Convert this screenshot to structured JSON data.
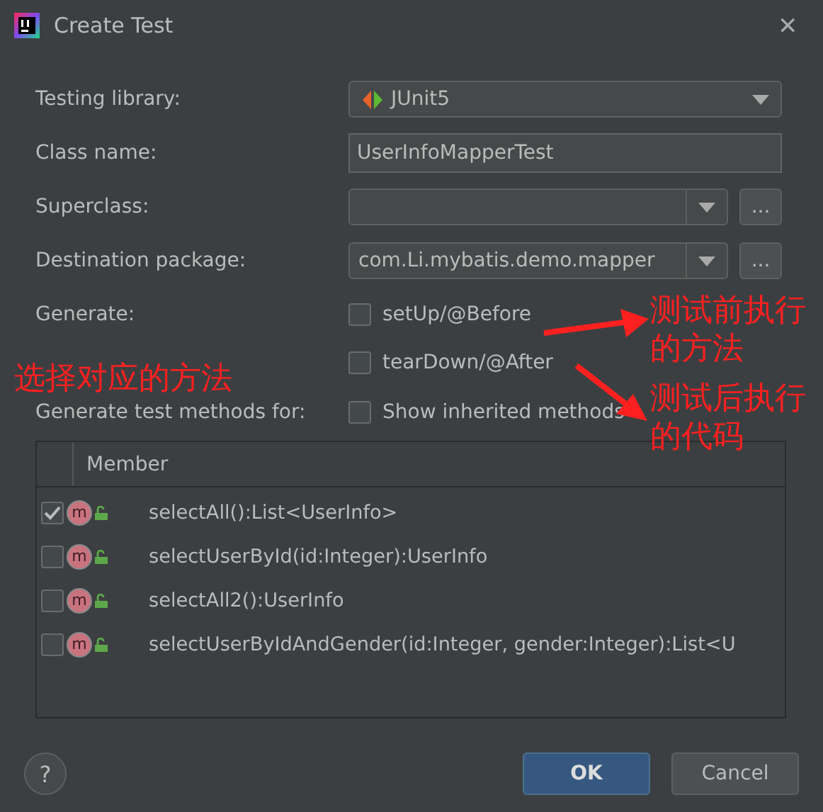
{
  "window": {
    "title": "Create Test",
    "close": "✕"
  },
  "form": {
    "testing_library": {
      "label": "Testing library:",
      "value": "JUnit5"
    },
    "class_name": {
      "label": "Class name:",
      "value": "UserInfoMapperTest"
    },
    "superclass": {
      "label": "Superclass:",
      "browse": "..."
    },
    "destination_package": {
      "label": "Destination package:",
      "value": "com.Li.mybatis.demo.mapper",
      "browse": "..."
    },
    "generate": {
      "label": "Generate:",
      "options": [
        {
          "label": "setUp/@Before",
          "checked": false
        },
        {
          "label": "tearDown/@After",
          "checked": false
        }
      ]
    },
    "methods_for": {
      "label": "Generate test methods for:",
      "option": {
        "label": "Show inherited methods",
        "checked": false
      }
    }
  },
  "table": {
    "columns": [
      "Member"
    ],
    "rows": [
      {
        "badge": "m",
        "name": "selectAll():List<UserInfo>",
        "checked": true
      },
      {
        "badge": "m",
        "name": "selectUserById(id:Integer):UserInfo",
        "checked": false
      },
      {
        "badge": "m",
        "name": "selectAll2():UserInfo",
        "checked": false
      },
      {
        "badge": "m",
        "name": "selectUserByIdAndGender(id:Integer, gender:Integer):List<U",
        "checked": false
      }
    ]
  },
  "buttons": {
    "help": "?",
    "ok": "OK",
    "cancel": "Cancel"
  },
  "annotations": [
    {
      "text": "测试前执行的方法",
      "kind": "right-top"
    },
    {
      "text": "选择对应的方法",
      "kind": "left"
    },
    {
      "text": "测试后执行的代码",
      "kind": "right-bottom"
    }
  ]
}
